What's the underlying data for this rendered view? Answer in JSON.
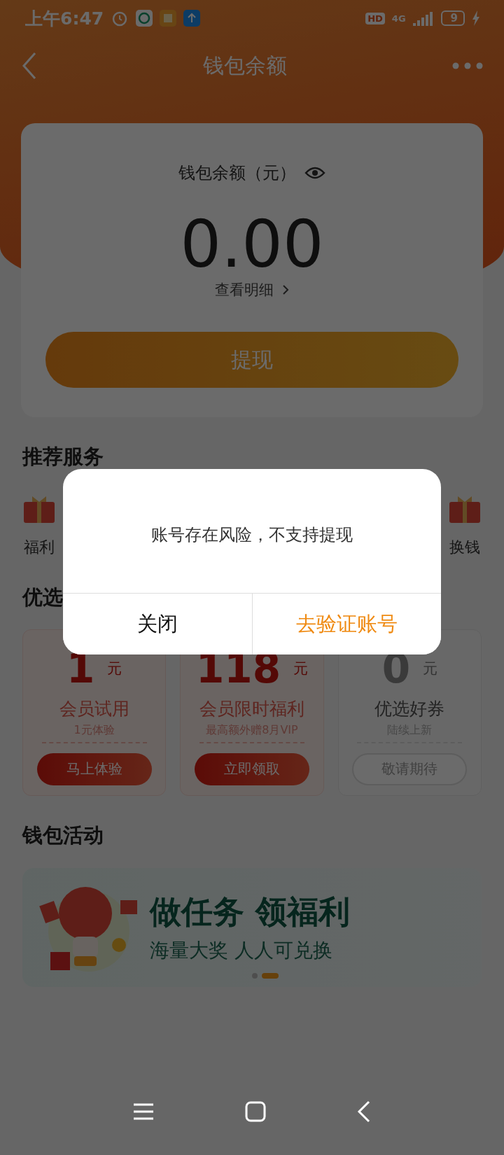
{
  "status_bar": {
    "time": "上午6:47",
    "hd": "HD",
    "network": "4G",
    "battery": "9"
  },
  "nav": {
    "title": "钱包余额"
  },
  "balance": {
    "label": "钱包余额（元）",
    "amount": "0.00",
    "detail_link": "查看明细",
    "withdraw_button": "提现"
  },
  "services": {
    "title": "推荐服务",
    "items": [
      {
        "label": "福利"
      },
      {
        "label": "换钱"
      }
    ]
  },
  "coupons": {
    "title": "优选",
    "items": [
      {
        "value": "1",
        "unit": "元",
        "title": "会员试用",
        "subtitle": "1元体验",
        "button": "马上体验",
        "kind": "active"
      },
      {
        "value": "118",
        "unit": "元",
        "title": "会员限时福利",
        "subtitle": "最高额外赠8月VIP",
        "button": "立即领取",
        "kind": "active"
      },
      {
        "value": "0",
        "unit": "元",
        "title": "优选好券",
        "subtitle": "陆续上新",
        "button": "敬请期待",
        "kind": "pending"
      }
    ]
  },
  "activities": {
    "title": "钱包活动",
    "banner": {
      "headline": "做任务 领福利",
      "subline": "海量大奖 人人可兑换",
      "dots": [
        {
          "selected": false
        },
        {
          "selected": true
        }
      ]
    }
  },
  "dialog": {
    "message": "账号存在风险，不支持提现",
    "buttons": [
      {
        "label": "关闭",
        "kind": "cancel"
      },
      {
        "label": "去验证账号",
        "kind": "primary"
      }
    ]
  }
}
